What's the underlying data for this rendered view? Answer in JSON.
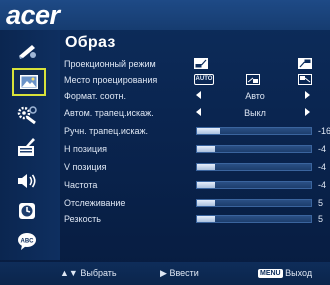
{
  "brand": {
    "logo": "acer"
  },
  "menu": {
    "title": "Образ"
  },
  "sidebar": {
    "items": [
      {
        "name": "color-icon"
      },
      {
        "name": "image-icon",
        "active": true
      },
      {
        "name": "management-icon"
      },
      {
        "name": "settings-icon"
      },
      {
        "name": "audio-icon"
      },
      {
        "name": "timer-icon"
      },
      {
        "name": "language-icon"
      }
    ]
  },
  "rows": {
    "projection_mode": {
      "label": "Проекционный режим"
    },
    "projection_location": {
      "label": "Место проецирования",
      "option_auto": "AUTO"
    },
    "aspect_ratio": {
      "label": "Формат. соотн.",
      "value": "Авто"
    },
    "auto_keystone": {
      "label": "Автом. трапец.искаж.",
      "value": "Выкл"
    },
    "manual_keystone": {
      "label": "Ручн. трапец.искаж.",
      "value": "-16",
      "level": 0.2
    },
    "h_position": {
      "label": "Н позиция",
      "value": "-4",
      "level": 0.16
    },
    "v_position": {
      "label": "V позиция",
      "value": "-4",
      "level": 0.16
    },
    "frequency": {
      "label": "Частота",
      "value": "-4",
      "level": 0.16
    },
    "tracking": {
      "label": "Отслеживание",
      "value": "5",
      "level": 0.16
    },
    "sharpness": {
      "label": "Резкость",
      "value": "5",
      "level": 0.16
    }
  },
  "footer": {
    "select_label": "Выбрать",
    "enter_label": "Ввести",
    "menu_key": "MENU",
    "exit_label": "Выход"
  }
}
